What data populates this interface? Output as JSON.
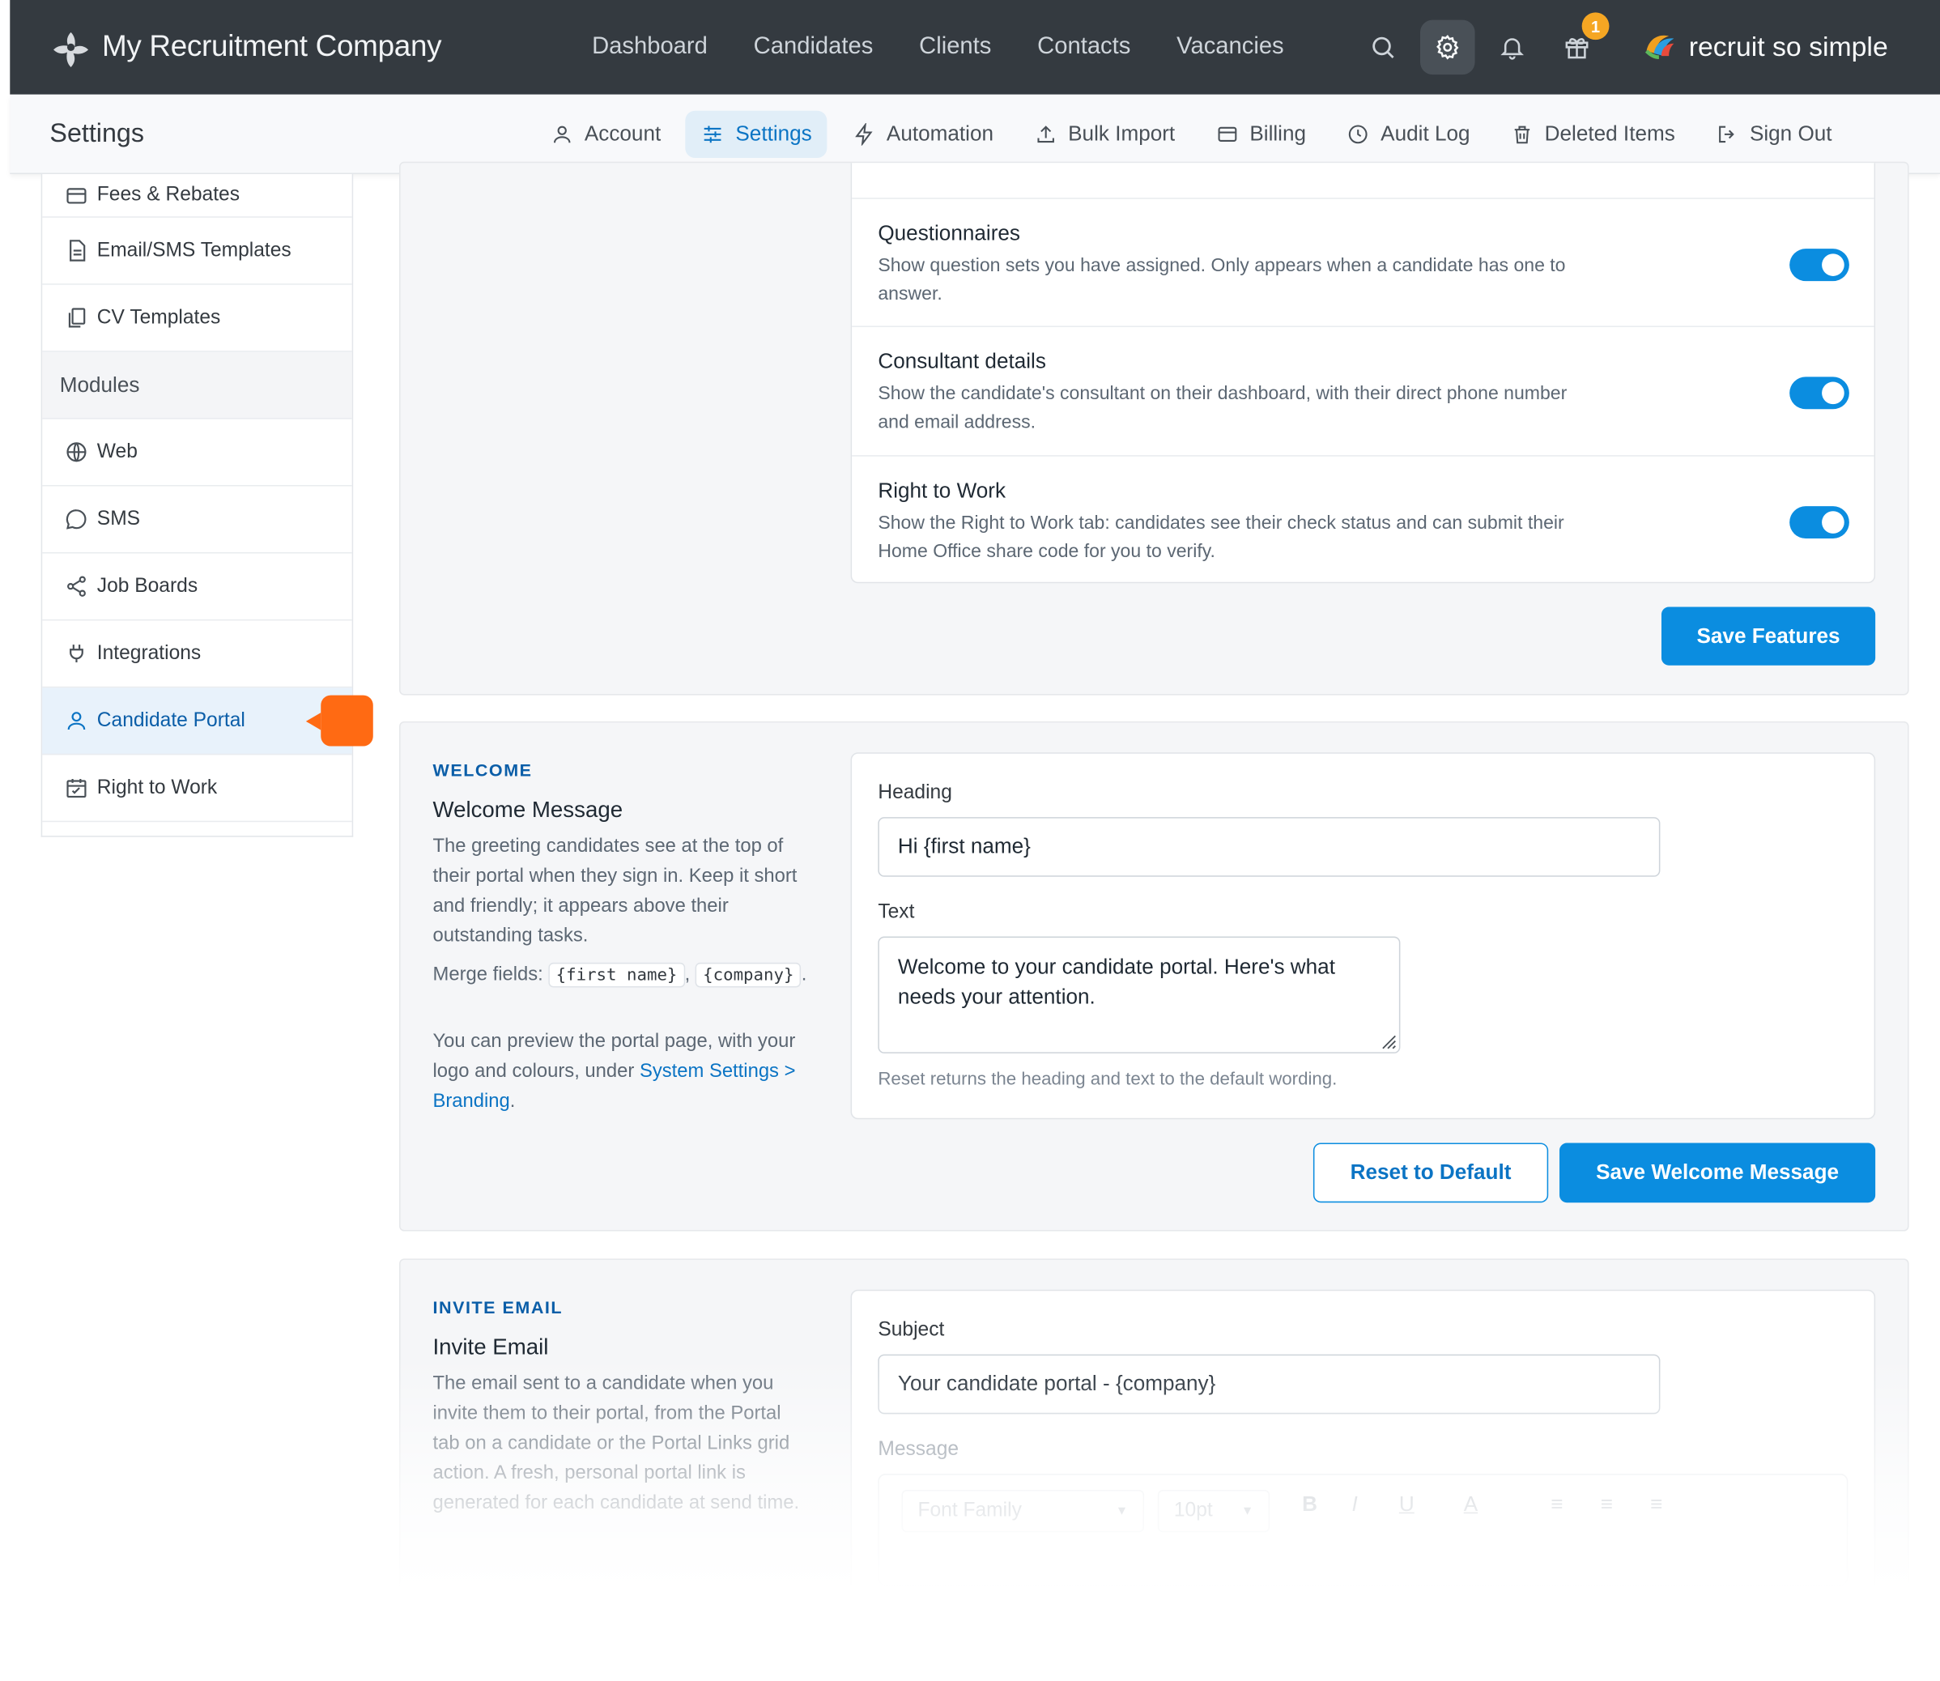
{
  "topnav": {
    "brand_name": "My Recruitment Company",
    "links": [
      "Dashboard",
      "Candidates",
      "Clients",
      "Contacts",
      "Vacancies"
    ],
    "gift_badge": "1",
    "product_name": "recruit so simple"
  },
  "subnav": {
    "title": "Settings",
    "tabs": [
      {
        "label": "Account",
        "icon": "user-icon"
      },
      {
        "label": "Settings",
        "icon": "sliders-icon"
      },
      {
        "label": "Automation",
        "icon": "bolt-icon"
      },
      {
        "label": "Bulk Import",
        "icon": "upload-icon"
      },
      {
        "label": "Billing",
        "icon": "card-icon"
      },
      {
        "label": "Audit Log",
        "icon": "clock-icon"
      },
      {
        "label": "Deleted Items",
        "icon": "trash-icon"
      },
      {
        "label": "Sign Out",
        "icon": "sign-out-icon"
      }
    ]
  },
  "sidebar": {
    "items": [
      {
        "label": "Fees & Rebates",
        "icon": "card-icon"
      },
      {
        "label": "Email/SMS Templates",
        "icon": "document-icon"
      },
      {
        "label": "CV Templates",
        "icon": "copy-icon"
      },
      {
        "label": "Modules",
        "icon": ""
      },
      {
        "label": "Web",
        "icon": "globe-icon"
      },
      {
        "label": "SMS",
        "icon": "chat-icon"
      },
      {
        "label": "Job Boards",
        "icon": "share-icon"
      },
      {
        "label": "Integrations",
        "icon": "plug-icon"
      },
      {
        "label": "Candidate Portal",
        "icon": "user-icon"
      },
      {
        "label": "Right to Work",
        "icon": "calendar-icon"
      }
    ]
  },
  "features": {
    "rows": [
      {
        "title": "Questionnaires",
        "description": "Show question sets you have assigned. Only appears when a candidate has one to answer.",
        "enabled": true
      },
      {
        "title": "Consultant details",
        "description": "Show the candidate's consultant on their dashboard, with their direct phone number and email address.",
        "enabled": true
      },
      {
        "title": "Right to Work",
        "description": "Show the Right to Work tab: candidates see their check status and can submit their Home Office share code for you to verify.",
        "enabled": true
      }
    ],
    "save_label": "Save Features"
  },
  "welcome": {
    "tag": "WELCOME",
    "title": "Welcome Message",
    "description": "The greeting candidates see at the top of their portal when they sign in. Keep it short and friendly; it appears above their outstanding tasks.",
    "merge_prefix": "Merge fields:",
    "merge_field_1": "{first name}",
    "merge_field_2": "{company}",
    "preview_text": "You can preview the portal page, with your logo and colours, under",
    "preview_link": "System Settings > Branding",
    "heading_label": "Heading",
    "heading_value": "Hi {first name}",
    "text_label": "Text",
    "text_value": "Welcome to your candidate portal. Here's what needs your attention.",
    "help": "Reset returns the heading and text to the default wording.",
    "reset_label": "Reset to Default",
    "save_label": "Save Welcome Message"
  },
  "invite": {
    "tag": "INVITE EMAIL",
    "title": "Invite Email",
    "description": "The email sent to a candidate when you invite them to their portal, from the Portal tab on a candidate or the Portal Links grid action. A fresh, personal portal link is generated for each candidate at send time.",
    "subject_label": "Subject",
    "subject_value": "Your candidate portal - {company}",
    "message_label": "Message",
    "toolbar": {
      "font_family": "Font Family",
      "font_size": "10pt",
      "bold": "B",
      "italic": "I",
      "underline": "U",
      "color": "A"
    }
  },
  "colors": {
    "accent": "#0b8de0",
    "topbar": "#343a40",
    "pointer": "#ff6a13",
    "badge": "#f5a623"
  }
}
